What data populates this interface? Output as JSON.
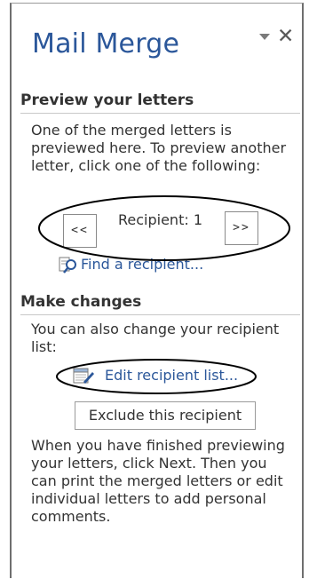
{
  "pane": {
    "title": "Mail Merge",
    "options_icon": "dropdown-triangle-icon",
    "close_icon": "close-icon"
  },
  "preview": {
    "heading": "Preview your letters",
    "description": "One of the merged letters is previewed here. To preview another letter, click one of the following:",
    "prev_button": "<<",
    "next_button": ">>",
    "recipient_label": "Recipient: 1",
    "find_link": "Find a recipient...",
    "find_icon": "find-magnifier-icon"
  },
  "changes": {
    "heading": "Make changes",
    "description": "You can also change your recipient list:",
    "edit_link": "Edit recipient list...",
    "edit_icon": "edit-list-icon",
    "exclude_button": "Exclude this recipient",
    "finish_text": "When you have finished previewing your letters, click Next. Then you can print the merged letters or edit individual letters to add personal comments."
  },
  "colors": {
    "accent": "#2b579a",
    "text": "#333333",
    "annotation": "#000000"
  }
}
